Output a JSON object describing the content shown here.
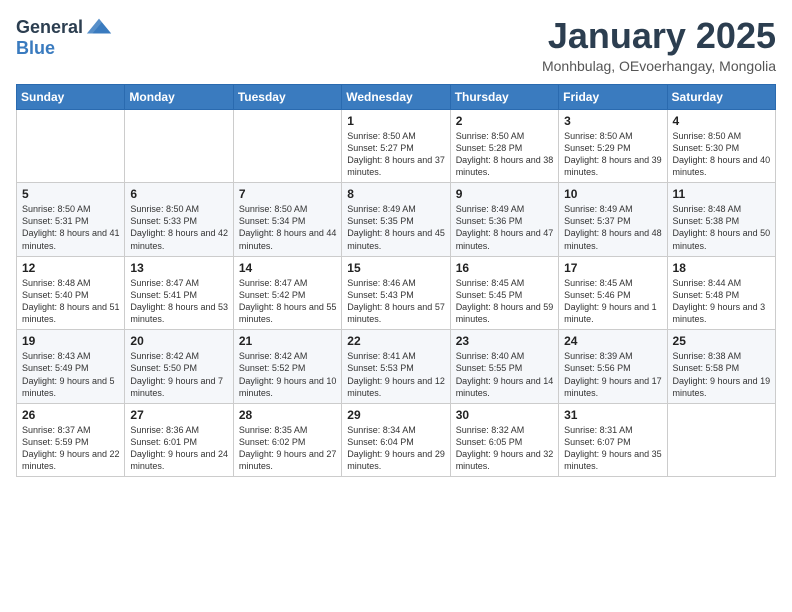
{
  "header": {
    "logo_general": "General",
    "logo_blue": "Blue",
    "month_title": "January 2025",
    "subtitle": "Monhbulag, OEvoerhangay, Mongolia"
  },
  "weekdays": [
    "Sunday",
    "Monday",
    "Tuesday",
    "Wednesday",
    "Thursday",
    "Friday",
    "Saturday"
  ],
  "weeks": [
    [
      {
        "day": "",
        "content": ""
      },
      {
        "day": "",
        "content": ""
      },
      {
        "day": "",
        "content": ""
      },
      {
        "day": "1",
        "content": "Sunrise: 8:50 AM\nSunset: 5:27 PM\nDaylight: 8 hours and 37 minutes."
      },
      {
        "day": "2",
        "content": "Sunrise: 8:50 AM\nSunset: 5:28 PM\nDaylight: 8 hours and 38 minutes."
      },
      {
        "day": "3",
        "content": "Sunrise: 8:50 AM\nSunset: 5:29 PM\nDaylight: 8 hours and 39 minutes."
      },
      {
        "day": "4",
        "content": "Sunrise: 8:50 AM\nSunset: 5:30 PM\nDaylight: 8 hours and 40 minutes."
      }
    ],
    [
      {
        "day": "5",
        "content": "Sunrise: 8:50 AM\nSunset: 5:31 PM\nDaylight: 8 hours and 41 minutes."
      },
      {
        "day": "6",
        "content": "Sunrise: 8:50 AM\nSunset: 5:33 PM\nDaylight: 8 hours and 42 minutes."
      },
      {
        "day": "7",
        "content": "Sunrise: 8:50 AM\nSunset: 5:34 PM\nDaylight: 8 hours and 44 minutes."
      },
      {
        "day": "8",
        "content": "Sunrise: 8:49 AM\nSunset: 5:35 PM\nDaylight: 8 hours and 45 minutes."
      },
      {
        "day": "9",
        "content": "Sunrise: 8:49 AM\nSunset: 5:36 PM\nDaylight: 8 hours and 47 minutes."
      },
      {
        "day": "10",
        "content": "Sunrise: 8:49 AM\nSunset: 5:37 PM\nDaylight: 8 hours and 48 minutes."
      },
      {
        "day": "11",
        "content": "Sunrise: 8:48 AM\nSunset: 5:38 PM\nDaylight: 8 hours and 50 minutes."
      }
    ],
    [
      {
        "day": "12",
        "content": "Sunrise: 8:48 AM\nSunset: 5:40 PM\nDaylight: 8 hours and 51 minutes."
      },
      {
        "day": "13",
        "content": "Sunrise: 8:47 AM\nSunset: 5:41 PM\nDaylight: 8 hours and 53 minutes."
      },
      {
        "day": "14",
        "content": "Sunrise: 8:47 AM\nSunset: 5:42 PM\nDaylight: 8 hours and 55 minutes."
      },
      {
        "day": "15",
        "content": "Sunrise: 8:46 AM\nSunset: 5:43 PM\nDaylight: 8 hours and 57 minutes."
      },
      {
        "day": "16",
        "content": "Sunrise: 8:45 AM\nSunset: 5:45 PM\nDaylight: 8 hours and 59 minutes."
      },
      {
        "day": "17",
        "content": "Sunrise: 8:45 AM\nSunset: 5:46 PM\nDaylight: 9 hours and 1 minute."
      },
      {
        "day": "18",
        "content": "Sunrise: 8:44 AM\nSunset: 5:48 PM\nDaylight: 9 hours and 3 minutes."
      }
    ],
    [
      {
        "day": "19",
        "content": "Sunrise: 8:43 AM\nSunset: 5:49 PM\nDaylight: 9 hours and 5 minutes."
      },
      {
        "day": "20",
        "content": "Sunrise: 8:42 AM\nSunset: 5:50 PM\nDaylight: 9 hours and 7 minutes."
      },
      {
        "day": "21",
        "content": "Sunrise: 8:42 AM\nSunset: 5:52 PM\nDaylight: 9 hours and 10 minutes."
      },
      {
        "day": "22",
        "content": "Sunrise: 8:41 AM\nSunset: 5:53 PM\nDaylight: 9 hours and 12 minutes."
      },
      {
        "day": "23",
        "content": "Sunrise: 8:40 AM\nSunset: 5:55 PM\nDaylight: 9 hours and 14 minutes."
      },
      {
        "day": "24",
        "content": "Sunrise: 8:39 AM\nSunset: 5:56 PM\nDaylight: 9 hours and 17 minutes."
      },
      {
        "day": "25",
        "content": "Sunrise: 8:38 AM\nSunset: 5:58 PM\nDaylight: 9 hours and 19 minutes."
      }
    ],
    [
      {
        "day": "26",
        "content": "Sunrise: 8:37 AM\nSunset: 5:59 PM\nDaylight: 9 hours and 22 minutes."
      },
      {
        "day": "27",
        "content": "Sunrise: 8:36 AM\nSunset: 6:01 PM\nDaylight: 9 hours and 24 minutes."
      },
      {
        "day": "28",
        "content": "Sunrise: 8:35 AM\nSunset: 6:02 PM\nDaylight: 9 hours and 27 minutes."
      },
      {
        "day": "29",
        "content": "Sunrise: 8:34 AM\nSunset: 6:04 PM\nDaylight: 9 hours and 29 minutes."
      },
      {
        "day": "30",
        "content": "Sunrise: 8:32 AM\nSunset: 6:05 PM\nDaylight: 9 hours and 32 minutes."
      },
      {
        "day": "31",
        "content": "Sunrise: 8:31 AM\nSunset: 6:07 PM\nDaylight: 9 hours and 35 minutes."
      },
      {
        "day": "",
        "content": ""
      }
    ]
  ]
}
